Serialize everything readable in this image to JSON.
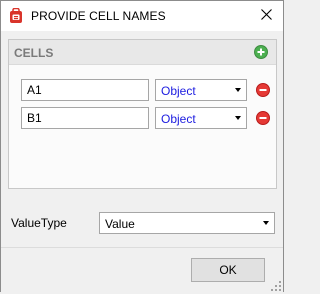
{
  "window": {
    "title": "PROVIDE CELL NAMES"
  },
  "cells": {
    "header": "CELLS",
    "rows": [
      {
        "name": "A1",
        "type": "Object"
      },
      {
        "name": "B1",
        "type": "Object"
      }
    ]
  },
  "value_type": {
    "label": "ValueType",
    "selected": "Value"
  },
  "footer": {
    "ok_label": "OK"
  },
  "colors": {
    "add_green": "#4caf50",
    "remove_red": "#e53935",
    "type_text_blue": "#1c1ce0",
    "app_icon_red": "#d9342b"
  }
}
